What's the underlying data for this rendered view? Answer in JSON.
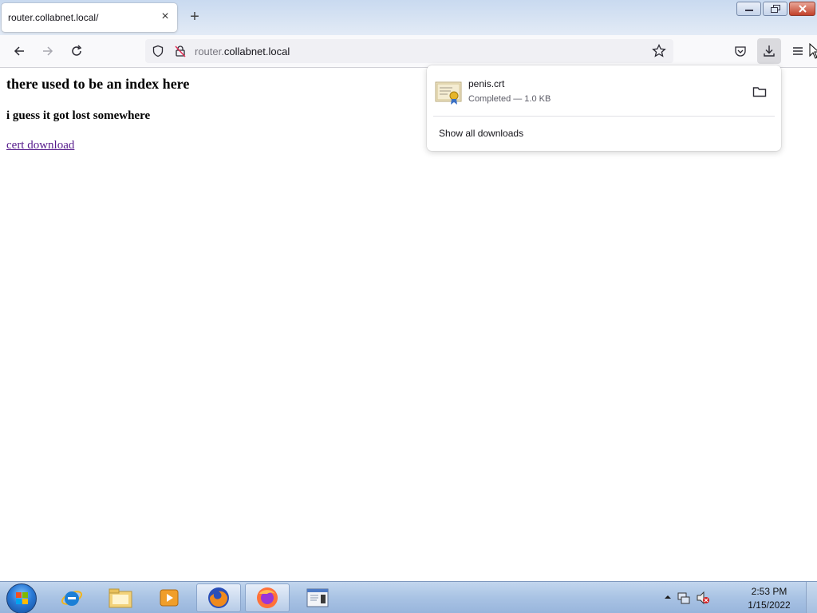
{
  "tab": {
    "title": "router.collabnet.local/",
    "close": "×",
    "new_tab": "+"
  },
  "urlbar": {
    "host_prefix": "router.",
    "host_domain": "collabnet.local"
  },
  "page": {
    "heading": "there used to be an index here",
    "subheading": "i guess it got lost somewhere",
    "link": "cert download"
  },
  "downloads": {
    "items": [
      {
        "name": "penis.crt",
        "status": "Completed — 1.0 KB",
        "icon": "certificate-file-icon"
      }
    ],
    "show_all": "Show all downloads"
  },
  "taskbar": {
    "time": "2:53 PM",
    "date": "1/15/2022",
    "apps": [
      "internet-explorer-icon",
      "file-explorer-icon",
      "media-player-icon",
      "firefox-icon",
      "firefox-icon",
      "window-icon"
    ]
  },
  "colors": {
    "visited_link": "#551a8b",
    "taskbar": "#a9c3e4",
    "close_button": "#c2412a"
  }
}
